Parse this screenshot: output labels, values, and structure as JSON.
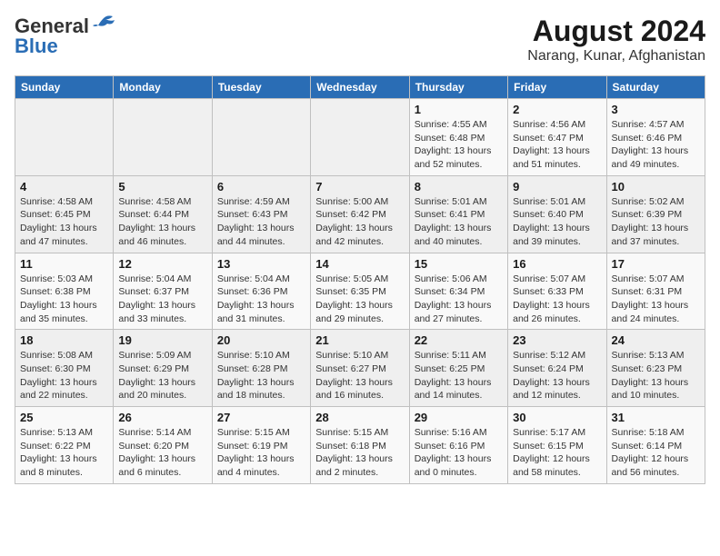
{
  "logo": {
    "text_general": "General",
    "text_blue": "Blue"
  },
  "title": "August 2024",
  "subtitle": "Narang, Kunar, Afghanistan",
  "days_of_week": [
    "Sunday",
    "Monday",
    "Tuesday",
    "Wednesday",
    "Thursday",
    "Friday",
    "Saturday"
  ],
  "weeks": [
    [
      {
        "day": "",
        "info": ""
      },
      {
        "day": "",
        "info": ""
      },
      {
        "day": "",
        "info": ""
      },
      {
        "day": "",
        "info": ""
      },
      {
        "day": "1",
        "info": "Sunrise: 4:55 AM\nSunset: 6:48 PM\nDaylight: 13 hours\nand 52 minutes."
      },
      {
        "day": "2",
        "info": "Sunrise: 4:56 AM\nSunset: 6:47 PM\nDaylight: 13 hours\nand 51 minutes."
      },
      {
        "day": "3",
        "info": "Sunrise: 4:57 AM\nSunset: 6:46 PM\nDaylight: 13 hours\nand 49 minutes."
      }
    ],
    [
      {
        "day": "4",
        "info": "Sunrise: 4:58 AM\nSunset: 6:45 PM\nDaylight: 13 hours\nand 47 minutes."
      },
      {
        "day": "5",
        "info": "Sunrise: 4:58 AM\nSunset: 6:44 PM\nDaylight: 13 hours\nand 46 minutes."
      },
      {
        "day": "6",
        "info": "Sunrise: 4:59 AM\nSunset: 6:43 PM\nDaylight: 13 hours\nand 44 minutes."
      },
      {
        "day": "7",
        "info": "Sunrise: 5:00 AM\nSunset: 6:42 PM\nDaylight: 13 hours\nand 42 minutes."
      },
      {
        "day": "8",
        "info": "Sunrise: 5:01 AM\nSunset: 6:41 PM\nDaylight: 13 hours\nand 40 minutes."
      },
      {
        "day": "9",
        "info": "Sunrise: 5:01 AM\nSunset: 6:40 PM\nDaylight: 13 hours\nand 39 minutes."
      },
      {
        "day": "10",
        "info": "Sunrise: 5:02 AM\nSunset: 6:39 PM\nDaylight: 13 hours\nand 37 minutes."
      }
    ],
    [
      {
        "day": "11",
        "info": "Sunrise: 5:03 AM\nSunset: 6:38 PM\nDaylight: 13 hours\nand 35 minutes."
      },
      {
        "day": "12",
        "info": "Sunrise: 5:04 AM\nSunset: 6:37 PM\nDaylight: 13 hours\nand 33 minutes."
      },
      {
        "day": "13",
        "info": "Sunrise: 5:04 AM\nSunset: 6:36 PM\nDaylight: 13 hours\nand 31 minutes."
      },
      {
        "day": "14",
        "info": "Sunrise: 5:05 AM\nSunset: 6:35 PM\nDaylight: 13 hours\nand 29 minutes."
      },
      {
        "day": "15",
        "info": "Sunrise: 5:06 AM\nSunset: 6:34 PM\nDaylight: 13 hours\nand 27 minutes."
      },
      {
        "day": "16",
        "info": "Sunrise: 5:07 AM\nSunset: 6:33 PM\nDaylight: 13 hours\nand 26 minutes."
      },
      {
        "day": "17",
        "info": "Sunrise: 5:07 AM\nSunset: 6:31 PM\nDaylight: 13 hours\nand 24 minutes."
      }
    ],
    [
      {
        "day": "18",
        "info": "Sunrise: 5:08 AM\nSunset: 6:30 PM\nDaylight: 13 hours\nand 22 minutes."
      },
      {
        "day": "19",
        "info": "Sunrise: 5:09 AM\nSunset: 6:29 PM\nDaylight: 13 hours\nand 20 minutes."
      },
      {
        "day": "20",
        "info": "Sunrise: 5:10 AM\nSunset: 6:28 PM\nDaylight: 13 hours\nand 18 minutes."
      },
      {
        "day": "21",
        "info": "Sunrise: 5:10 AM\nSunset: 6:27 PM\nDaylight: 13 hours\nand 16 minutes."
      },
      {
        "day": "22",
        "info": "Sunrise: 5:11 AM\nSunset: 6:25 PM\nDaylight: 13 hours\nand 14 minutes."
      },
      {
        "day": "23",
        "info": "Sunrise: 5:12 AM\nSunset: 6:24 PM\nDaylight: 13 hours\nand 12 minutes."
      },
      {
        "day": "24",
        "info": "Sunrise: 5:13 AM\nSunset: 6:23 PM\nDaylight: 13 hours\nand 10 minutes."
      }
    ],
    [
      {
        "day": "25",
        "info": "Sunrise: 5:13 AM\nSunset: 6:22 PM\nDaylight: 13 hours\nand 8 minutes."
      },
      {
        "day": "26",
        "info": "Sunrise: 5:14 AM\nSunset: 6:20 PM\nDaylight: 13 hours\nand 6 minutes."
      },
      {
        "day": "27",
        "info": "Sunrise: 5:15 AM\nSunset: 6:19 PM\nDaylight: 13 hours\nand 4 minutes."
      },
      {
        "day": "28",
        "info": "Sunrise: 5:15 AM\nSunset: 6:18 PM\nDaylight: 13 hours\nand 2 minutes."
      },
      {
        "day": "29",
        "info": "Sunrise: 5:16 AM\nSunset: 6:16 PM\nDaylight: 13 hours\nand 0 minutes."
      },
      {
        "day": "30",
        "info": "Sunrise: 5:17 AM\nSunset: 6:15 PM\nDaylight: 12 hours\nand 58 minutes."
      },
      {
        "day": "31",
        "info": "Sunrise: 5:18 AM\nSunset: 6:14 PM\nDaylight: 12 hours\nand 56 minutes."
      }
    ]
  ]
}
